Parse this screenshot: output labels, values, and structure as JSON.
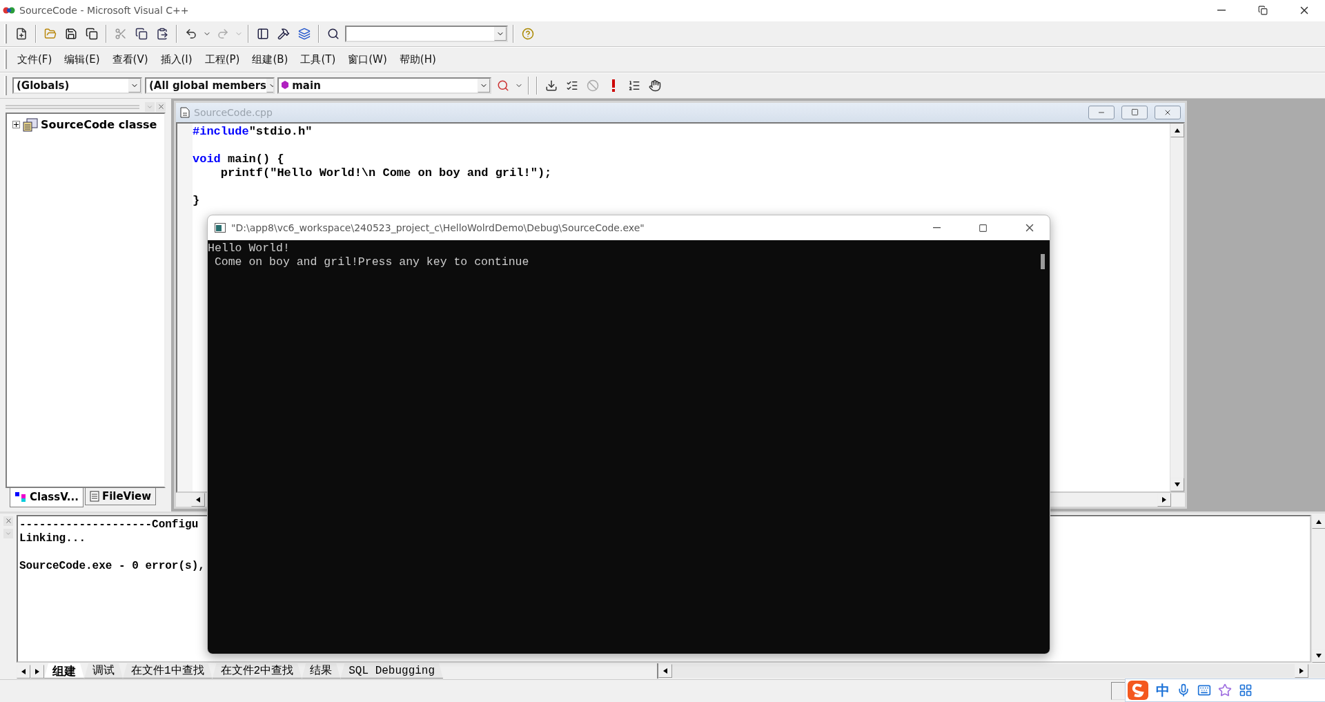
{
  "window": {
    "title": "SourceCode - Microsoft Visual C++"
  },
  "menu": [
    {
      "label": "文件(F)"
    },
    {
      "label": "编辑(E)"
    },
    {
      "label": "查看(V)"
    },
    {
      "label": "插入(I)"
    },
    {
      "label": "工程(P)"
    },
    {
      "label": "组建(B)"
    },
    {
      "label": "工具(T)"
    },
    {
      "label": "窗口(W)"
    },
    {
      "label": "帮助(H)"
    }
  ],
  "wizard_bar": {
    "class": "(Globals)",
    "filter": "(All global members",
    "member": "main"
  },
  "workspace": {
    "tree": [
      {
        "label": "SourceCode classe",
        "expanded": false
      }
    ],
    "tabs": [
      {
        "label": "ClassV...",
        "selected": true
      },
      {
        "label": "FileView",
        "selected": false
      }
    ]
  },
  "editor": {
    "title": "SourceCode.cpp",
    "lines": [
      {
        "kind": "code",
        "segments": [
          {
            "kind": "keyword",
            "text": "#include"
          },
          {
            "kind": "plain",
            "text": "\"stdio.h\""
          }
        ]
      },
      {
        "kind": "blank"
      },
      {
        "kind": "code",
        "segments": [
          {
            "kind": "keyword",
            "text": "void"
          },
          {
            "kind": "plain",
            "text": " main() {"
          }
        ]
      },
      {
        "kind": "code",
        "segments": [
          {
            "kind": "plain",
            "text": "    printf(\"Hello World!\\n Come on boy and gril!\");"
          }
        ]
      },
      {
        "kind": "blank"
      },
      {
        "kind": "code",
        "segments": [
          {
            "kind": "plain",
            "text": "}"
          }
        ]
      }
    ]
  },
  "output": {
    "lines": [
      {
        "kind": "text",
        "text": "--------------------Configu"
      },
      {
        "kind": "text",
        "text": "Linking..."
      },
      {
        "kind": "blank"
      },
      {
        "kind": "text",
        "text": "SourceCode.exe - 0 error(s),"
      }
    ],
    "tabs": [
      {
        "label": "组建",
        "selected": true
      },
      {
        "label": "调试",
        "selected": false
      },
      {
        "label": "在文件1中查找",
        "selected": false
      },
      {
        "label": "在文件2中查找",
        "selected": false
      },
      {
        "label": "结果",
        "selected": false
      },
      {
        "label": "SQL Debugging",
        "selected": false
      }
    ]
  },
  "console": {
    "title": "\"D:\\app8\\vc6_workspace\\240523_project_c\\HelloWolrdDemo\\Debug\\SourceCode.exe\"",
    "lines": [
      "Hello World!",
      " Come on boy and gril!Press any key to continue"
    ]
  },
  "ime": {
    "mode": "中"
  }
}
